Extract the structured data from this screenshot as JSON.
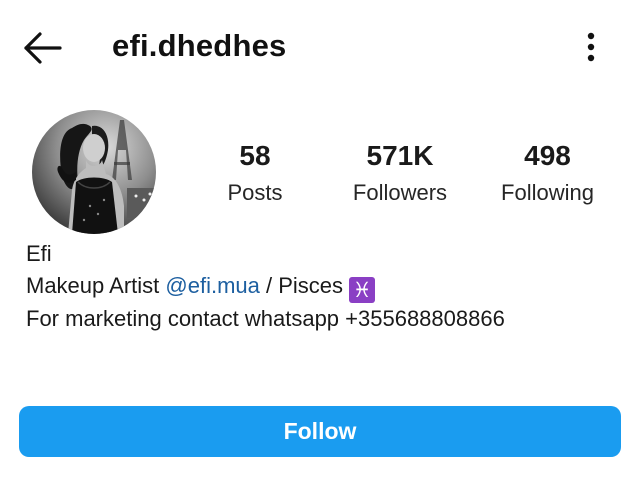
{
  "header": {
    "username": "efi.dhedhes",
    "back_icon": "arrow-left-icon",
    "more_icon": "more-vertical-icon"
  },
  "stats": {
    "posts": {
      "count": "58",
      "label": "Posts"
    },
    "followers": {
      "count": "571K",
      "label": "Followers"
    },
    "following": {
      "count": "498",
      "label": "Following"
    }
  },
  "bio": {
    "name": "Efi",
    "line1_prefix": "Makeup Artist ",
    "mention": "@efi.mua",
    "line1_suffix": " / Pisces ",
    "emoji": "♓",
    "line2": "For marketing contact whatsapp +355688808866"
  },
  "actions": {
    "follow_label": "Follow"
  },
  "colors": {
    "accent": "#1a9cf0",
    "mention": "#1d5fa0",
    "emoji_bg": "#8a3fc4"
  }
}
